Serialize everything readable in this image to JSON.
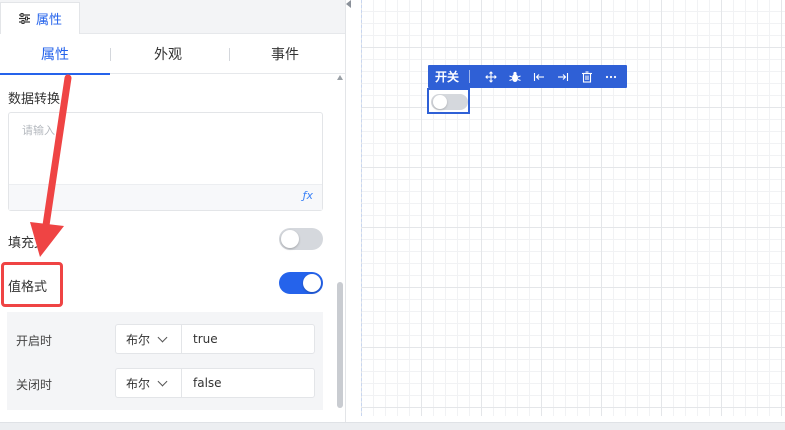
{
  "panel": {
    "tab_label": "属性",
    "tab_icon": "sliders-icon"
  },
  "subtabs": [
    {
      "label": "属性",
      "active": true
    },
    {
      "label": "外观",
      "active": false
    },
    {
      "label": "事件",
      "active": false
    }
  ],
  "data_transform": {
    "label": "数据转换",
    "placeholder": "请输入",
    "fx_label": "ƒx"
  },
  "fill_toggle": {
    "label": "填充文",
    "on": false
  },
  "value_format": {
    "label": "值格式",
    "on": true
  },
  "value_options": [
    {
      "label": "开启时",
      "type": "布尔",
      "value": "true"
    },
    {
      "label": "关闭时",
      "type": "布尔",
      "value": "false"
    }
  ],
  "canvas": {
    "toolbar_label": "开关",
    "toolbar_icons": [
      "move-icon",
      "debug-icon",
      "align-left-icon",
      "align-right-icon",
      "delete-icon",
      "more-icon"
    ]
  },
  "colors": {
    "accent": "#2563eb",
    "toolbar": "#2f60d6",
    "annotation": "#ef4444"
  }
}
